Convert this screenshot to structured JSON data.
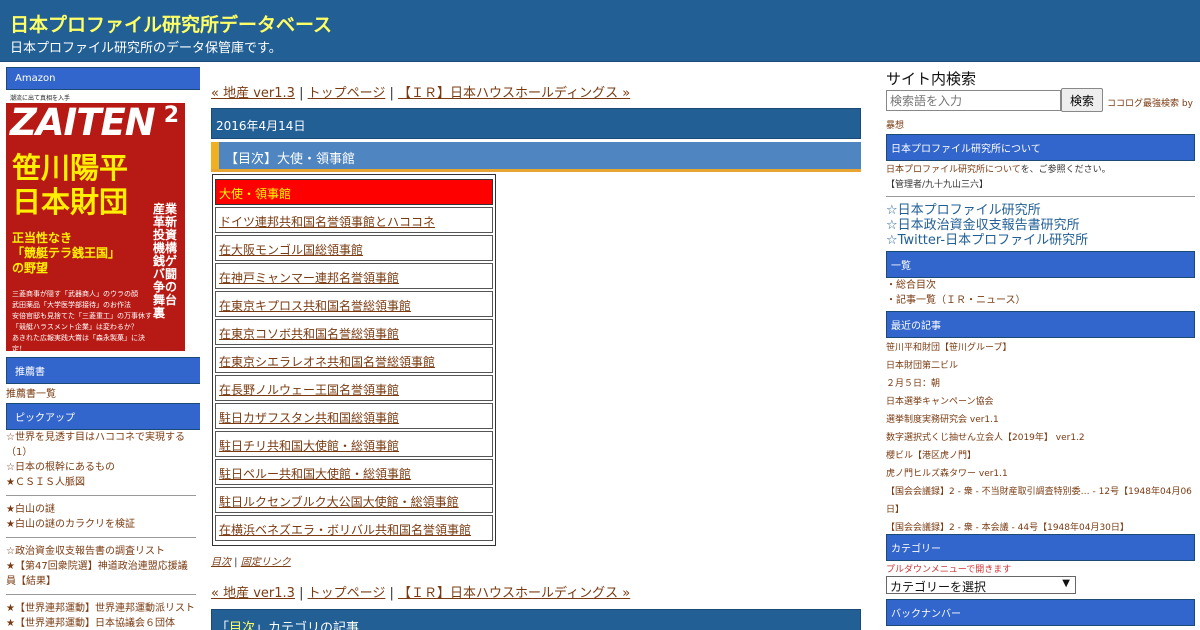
{
  "header": {
    "title": "日本プロファイル研究所データベース",
    "description": "日本プロファイル研究所のデータ保管庫です。"
  },
  "left": {
    "amazon_label": "Amazon",
    "magazine": {
      "top_text": "潮流に出て真相を入手",
      "logo": "ZAITEN",
      "issue": "2",
      "headline1": "笹川陽平",
      "headline2": "日本財団",
      "subhead": "正当性なき\n「競艇テラ銭王国」\nの野望",
      "vertical": "産業革新投資機構 銭ゲバ闘争の舞台裏",
      "small_lines": "三菱商事が隠す「武器商人」のウラの顔\n武田薬品「大学医学部接待」のお作法\n安倍官邸も見捨てた「三菱重工」の万事休す\n「競艇ハラスメント企業」は変わるか？\nあきれた広報実践大賞は「森永製菓」に決定！"
    },
    "recommended_label": "推薦書",
    "recommended_link": "推薦書一覧",
    "pickup_label": "ピックアップ",
    "pickup_groups": [
      [
        "☆世界を見透す目はハココネで実現する（1）",
        "☆日本の根幹にあるもの",
        "★ＣＳＩＳ人脈図"
      ],
      [
        "★白山の謎",
        "★白山の謎のカラクリを検証"
      ],
      [
        "☆政治資金収支報告書の調査リスト",
        "★【第47回衆院選】神道政治連盟応援議員【結果】"
      ],
      [
        "★【世界連邦運動】世界連邦運動派リスト",
        "★【世界連邦運動】日本協議会６団体"
      ]
    ]
  },
  "center": {
    "nav": {
      "prev": "« 地産 ver1.3",
      "sep1": " | ",
      "home": "トップページ",
      "sep2": " | ",
      "next": "【ＩＲ】日本ハウスホールディングス »"
    },
    "date": "2016年4月14日",
    "entry_title": "【目次】大使・領事館",
    "table_rows": [
      "大使・領事館",
      "ドイツ連邦共和国名誉領事館とハココネ",
      "在大阪モンゴル国総領事館",
      "在神戸ミャンマー連邦名誉領事館",
      "在東京キプロス共和国名誉総領事館",
      "在東京コソボ共和国名誉総領事館",
      "在東京シエラレオネ共和国名誉総領事館",
      "在長野ノルウェー王国名誉領事館",
      "駐日カザフスタン共和国総領事館",
      "駐日チリ共和国大使館・総領事館",
      "駐日ペルー共和国大使館・総領事館",
      "駐日ルクセンブルク大公国大使館・総領事館",
      "在横浜ベネズエラ・ボリバル共和国名誉領事館"
    ],
    "meta": {
      "category": "目次",
      "sep": " | ",
      "permalink": "固定リンク"
    },
    "category_bar": {
      "q_open": "「",
      "name": "目次",
      "q_close": "」カテゴリの記事"
    }
  },
  "right": {
    "search_title": "サイト内検索",
    "search_placeholder": "検索語を入力",
    "search_button": "検索",
    "search_by": "ココログ最強検索 by",
    "search_by2": "暴想",
    "about_head": "日本プロファイル研究所について",
    "about_link": "日本プロファイル研究所について",
    "about_suffix": "を、ご参照ください。",
    "about_admin": "【管理者/九十九山三六】",
    "big_links": [
      "☆日本プロファイル研究所",
      "☆日本政治資金収支報告書研究所",
      "☆Twitter-日本プロファイル研究所"
    ],
    "list_head": "一覧",
    "list_items": [
      "・総合目次",
      "・記事一覧（ＩＲ・ニュース）"
    ],
    "recent_head": "最近の記事",
    "recent_items": [
      "笹川平和財団【笹川グループ】",
      "日本財団第二ビル",
      "２月５日：朝",
      "日本選挙キャンペーン協会",
      "選挙制度実務研究会 ver1.1",
      "数字選択式くじ抽せん立会人【2019年】 ver1.2",
      "櫻ビル【港区虎ノ門】",
      "虎ノ門ヒルズ森タワー ver1.1",
      "【国会会議録】2 - 衆 - 不当財産取引調査特別委… - 12号【1948年04月06日】",
      "【国会会議録】2 - 衆 - 本会議 - 44号【1948年04月30日】"
    ],
    "category_head": "カテゴリー",
    "category_note": "プルダウンメニューで開きます",
    "category_select": "カテゴリーを選択",
    "backnumber_head": "バックナンバー"
  }
}
